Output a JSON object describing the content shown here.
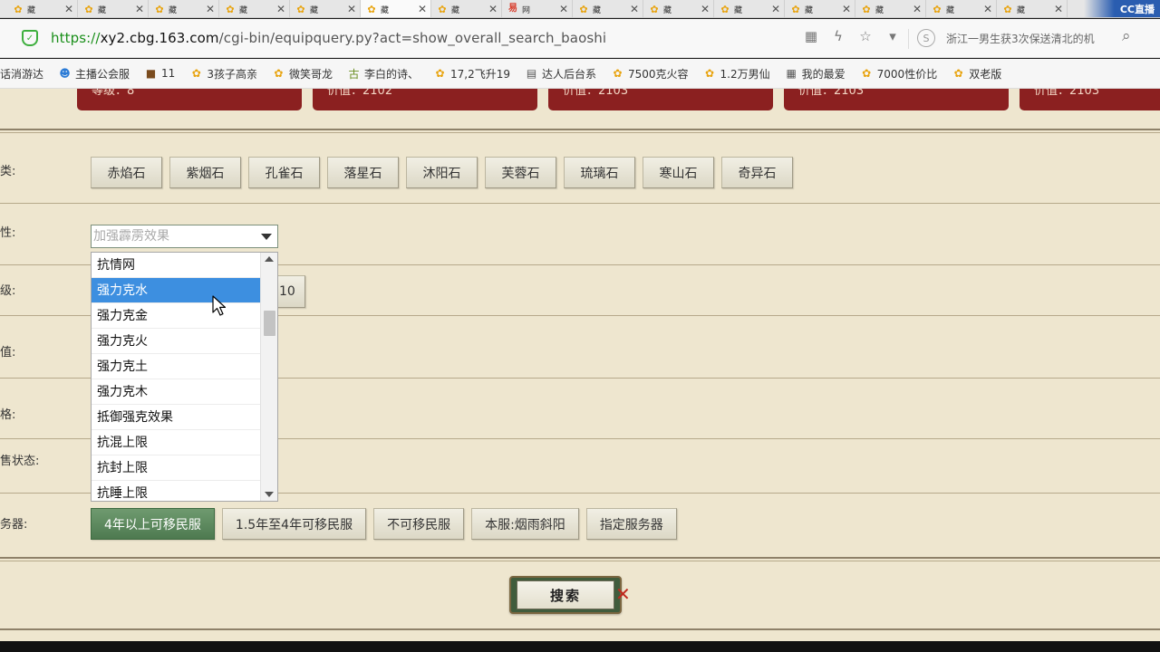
{
  "browser": {
    "tabs": [
      {
        "label": "藏",
        "icon": "qq-pet-icon",
        "active": false
      },
      {
        "label": "藏",
        "icon": "qq-pet-icon",
        "active": false
      },
      {
        "label": "藏",
        "icon": "qq-pet-icon",
        "active": false
      },
      {
        "label": "藏",
        "icon": "qq-pet-icon",
        "active": false
      },
      {
        "label": "藏",
        "icon": "qq-pet-icon",
        "active": false
      },
      {
        "label": "藏",
        "icon": "qq-pet-icon",
        "active": true
      },
      {
        "label": "藏",
        "icon": "qq-pet-icon",
        "active": false
      },
      {
        "label": "网",
        "icon": "netease-icon",
        "active": false
      },
      {
        "label": "藏",
        "icon": "qq-pet-icon",
        "active": false
      },
      {
        "label": "藏",
        "icon": "qq-pet-icon",
        "active": false
      },
      {
        "label": "藏",
        "icon": "qq-pet-icon",
        "active": false
      },
      {
        "label": "藏",
        "icon": "qq-pet-icon",
        "active": false
      },
      {
        "label": "藏",
        "icon": "qq-pet-icon",
        "active": false
      },
      {
        "label": "藏",
        "icon": "qq-pet-icon",
        "active": false
      },
      {
        "label": "藏",
        "icon": "qq-pet-icon",
        "active": false
      }
    ],
    "tab_close": "✕",
    "overlay_badge": "CC直播",
    "url_scheme": "https://",
    "url_host": "xy2.cbg.163.com",
    "url_path": "/cgi-bin/equipquery.py?act=show_overall_search_baoshi",
    "news_text": "浙江一男生获3次保送清北的机",
    "bookmarks": [
      {
        "label": "话消游达",
        "icon": "none"
      },
      {
        "label": "主播公会服",
        "icon": "face-icon"
      },
      {
        "label": "11",
        "icon": "game-icon"
      },
      {
        "label": "3孩子高亲",
        "icon": "qq-pet-icon"
      },
      {
        "label": "微笑哥龙",
        "icon": "qq-pet-icon"
      },
      {
        "label": "李白的诗、",
        "icon": "ancient-icon"
      },
      {
        "label": "17,2飞升19",
        "icon": "qq-pet-icon"
      },
      {
        "label": "达人后台系",
        "icon": "doc-icon"
      },
      {
        "label": "7500克火容",
        "icon": "qq-pet-icon"
      },
      {
        "label": "1.2万男仙",
        "icon": "qq-pet-icon"
      },
      {
        "label": "我的最爱",
        "icon": "grid-icon"
      },
      {
        "label": "7000性价比",
        "icon": "qq-pet-icon"
      },
      {
        "label": "双老版",
        "icon": "qq-pet-icon"
      }
    ]
  },
  "page": {
    "cards": [
      "等级：8",
      "价值：2102",
      "价值：2103",
      "价值：2103",
      "价值：2103"
    ],
    "labels": {
      "kind": "种类:",
      "attr": "属性:",
      "level": "等级:",
      "value": "价值:",
      "price": "价格:",
      "sale_status": "出售状态:",
      "server": "服务器:"
    },
    "stones": [
      "赤焰石",
      "紫烟石",
      "孔雀石",
      "落星石",
      "沐阳石",
      "芙蓉石",
      "琉璃石",
      "寒山石",
      "奇异石"
    ],
    "attribute_select": {
      "value": "加强霹雳效果"
    },
    "level_button_partial": "10",
    "dropdown_items": [
      "抗情网",
      "强力克水",
      "强力克金",
      "强力克火",
      "强力克土",
      "强力克木",
      "抵御强克效果",
      "抗混上限",
      "抗封上限",
      "抗睡上限"
    ],
    "dropdown_highlighted": "强力克水",
    "servers": [
      "4年以上可移民服",
      "1.5年至4年可移民服",
      "不可移民服",
      "本服:烟雨斜阳",
      "指定服务器"
    ],
    "server_selected": "4年以上可移民服",
    "search_label": "搜索"
  },
  "colors": {
    "page_bg": "#eee6cf",
    "card_bg": "#8b2020",
    "selected_server": "#5a845b",
    "dropdown_highlight": "#3d8fe0"
  }
}
